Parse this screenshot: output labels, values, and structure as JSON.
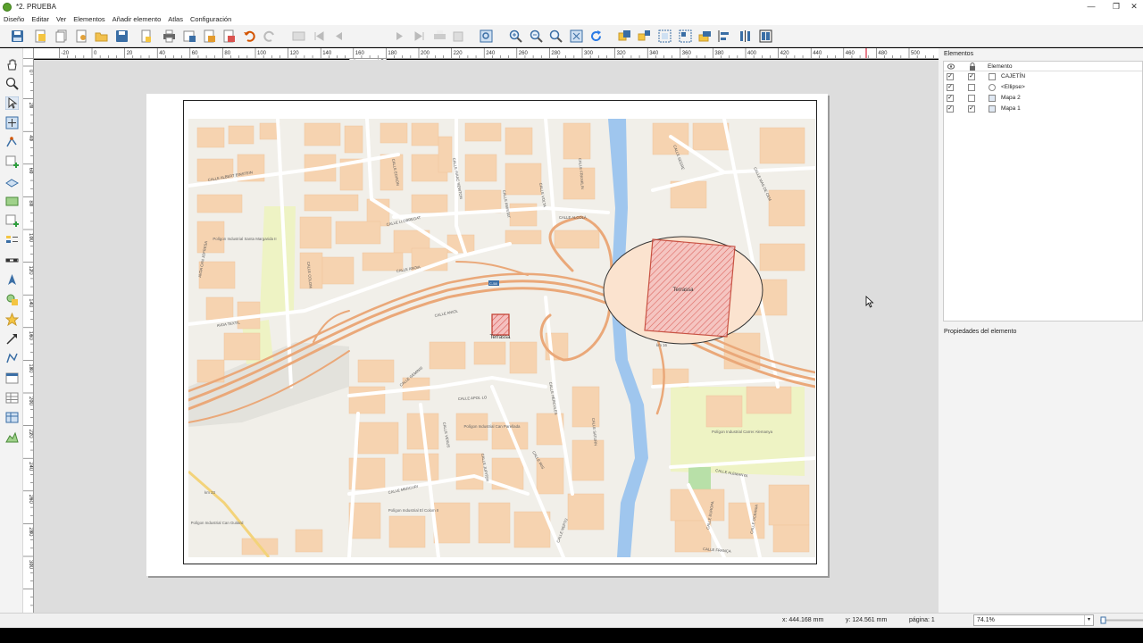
{
  "window": {
    "title": "*2. PRUEBA",
    "controls": [
      "—",
      "❐",
      "✕"
    ]
  },
  "menu": [
    "Diseño",
    "Editar",
    "Ver",
    "Elementos",
    "Añadir elemento",
    "Atlas",
    "Configuración"
  ],
  "toolbar": {
    "page_value": "1",
    "icons": [
      "save-icon",
      "new-layout-icon",
      "duplicate-layout-icon",
      "layout-manager-icon",
      "open-template-icon",
      "save-template-icon",
      "page-setup-icon",
      "print-icon",
      "export-image-icon",
      "export-svg-icon",
      "export-pdf-icon",
      "undo-icon",
      "redo-icon",
      "atlas-preview-icon",
      "first-feature-icon",
      "prev-feature-icon",
      "next-feature-icon",
      "last-feature-icon",
      "atlas-print-icon",
      "atlas-export-icon",
      "atlas-settings-icon",
      "zoom-in-icon",
      "zoom-out-icon",
      "zoom-100-icon",
      "zoom-full-icon",
      "refresh-icon",
      "group-icon",
      "ungroup-icon",
      "lock-items-icon",
      "unlock-items-icon",
      "raise-icon",
      "align-left-icon",
      "distribute-icon",
      "resize-icon"
    ]
  },
  "left_tools": [
    "pan-icon",
    "zoom-tool-icon",
    "select-icon",
    "move-content-icon",
    "edit-nodes-icon",
    "add-map-icon",
    "add-3d-map-icon",
    "add-picture-icon",
    "add-label-icon",
    "add-legend-icon",
    "add-scalebar-icon",
    "add-north-arrow-icon",
    "add-shape-icon",
    "add-marker-icon",
    "add-arrow-icon",
    "add-polyline-icon",
    "add-html-icon",
    "add-attribute-table-icon",
    "add-fixed-table-icon",
    "add-elevation-profile-icon"
  ],
  "ruler": {
    "h_labels": [
      "-20",
      "0",
      "20",
      "40",
      "60",
      "80",
      "100",
      "120",
      "140",
      "160",
      "180",
      "200",
      "220",
      "240",
      "260",
      "280",
      "300",
      "320",
      "340",
      "360",
      "380",
      "400",
      "420",
      "440",
      "460",
      "480",
      "500",
      "52"
    ],
    "v_labels": [
      "0",
      "20",
      "40",
      "60",
      "80",
      "100",
      "120",
      "140",
      "160",
      "180",
      "200",
      "220",
      "240",
      "260",
      "280",
      "300"
    ]
  },
  "map": {
    "streets": [
      "CALLE ALBERT EINSTEIN",
      "CALLE EDISON",
      "CALLE ISAAC NEWTON",
      "CALLE VOLTA",
      "CALLE FRANKLIN",
      "CALLE ALCOLÀ",
      "CALLE LLOBREGAT",
      "CALLE ANOIA",
      "CALLE AMISTAT",
      "CALLE COLOM",
      "AVDA TEXTIL",
      "CALLE ANIOL",
      "CALLE GEMINIS",
      "CALLE APOL·LO",
      "CALLE HÈRCULES",
      "CALLE SATURN",
      "CALLE VENUS",
      "CALLE JUPITER",
      "CALLE MERCURI",
      "CALLE NEPTÚ",
      "CALLE IRIS",
      "CALLE ALEMANYA",
      "CALLE EUROPA",
      "CALLE OCEANIA",
      "CALLE FRANÇA",
      "CALLE MAS DE CEM",
      "AVDA CAN JOFRESA",
      "CALLE SEGRE"
    ],
    "areas": [
      "Polígon Industrial Santa Margarida II",
      "Polígon Industrial Can Parellada",
      "Polígon Industrial El Colom II",
      "Polígon Industrial Can Guitard",
      "Polígon Industrial Carrer Alemanya"
    ],
    "road_codes": [
      "C-58",
      "km 23",
      "km 16"
    ],
    "feature_label": "Terrassa",
    "overview_label": "Terrassa"
  },
  "dock": {
    "title": "Elementos",
    "column_header": "Elemento",
    "items": [
      {
        "label": "CAJETÍN",
        "visible": true,
        "locked": true,
        "icon": "label-item-icon"
      },
      {
        "label": "<Ellipse>",
        "visible": true,
        "locked": false,
        "icon": "ellipse-item-icon"
      },
      {
        "label": "Mapa 2",
        "visible": true,
        "locked": false,
        "icon": "map-item-icon"
      },
      {
        "label": "Mapa 1",
        "visible": true,
        "locked": true,
        "icon": "map-item-icon"
      }
    ],
    "properties_title": "Propiedades del elemento"
  },
  "status": {
    "x": "x: 444.168 mm",
    "y": "y: 124.561 mm",
    "page": "página: 1",
    "zoom": "74.1%"
  },
  "colors": {
    "accent_red": "#c0392b",
    "river": "#9fc6ee",
    "building": "#f6d3b0",
    "road": "#eaa879"
  }
}
